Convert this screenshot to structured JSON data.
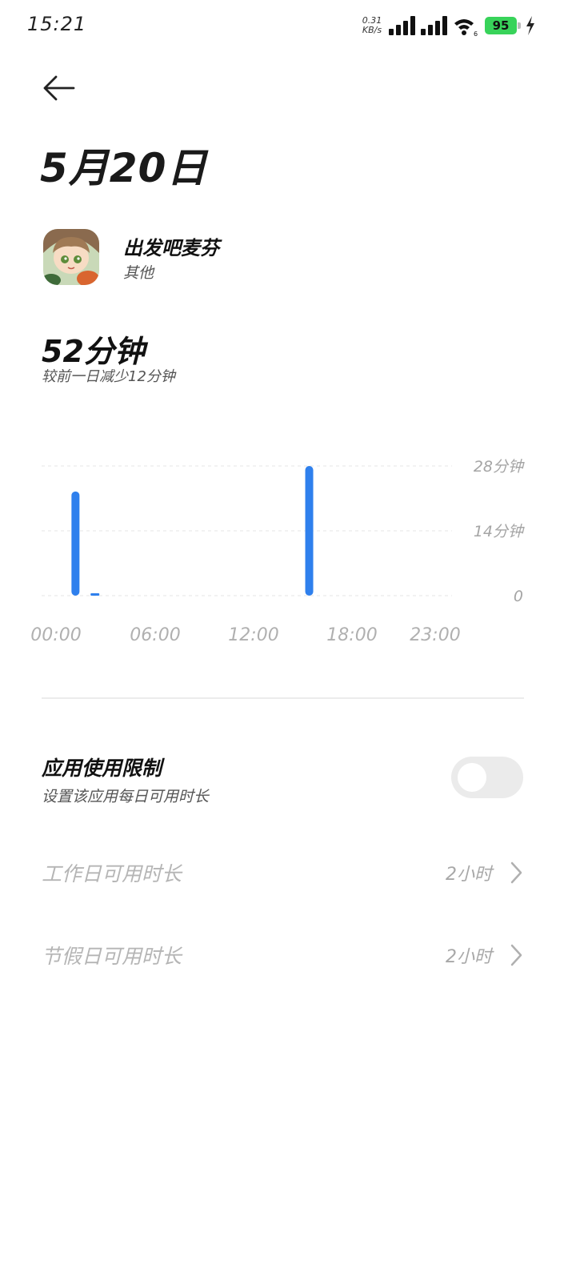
{
  "status_bar": {
    "time": "15:21",
    "net_speed_value": "0.31",
    "net_speed_unit": "KB/s",
    "battery": "95",
    "battery_color": "#38d35a"
  },
  "header": {
    "back_icon": "arrow-left-icon",
    "date_title": "5月20日"
  },
  "app": {
    "name": "出发吧麦芬",
    "category": "其他"
  },
  "usage": {
    "total": "52分钟",
    "compare": "较前一日减少12分钟"
  },
  "chart_data": {
    "type": "bar",
    "unit": "分钟",
    "ylim": [
      0,
      28
    ],
    "y_ticks": [
      {
        "value": 28,
        "label": "28分钟"
      },
      {
        "value": 14,
        "label": "14分钟"
      },
      {
        "value": 0,
        "label": "0"
      }
    ],
    "x_ticks": [
      "00:00",
      "06:00",
      "12:00",
      "18:00",
      "23:00"
    ],
    "hours": [
      0,
      1,
      2,
      3,
      4,
      5,
      6,
      7,
      8,
      9,
      10,
      11,
      12,
      13,
      14,
      15,
      16,
      17,
      18,
      19,
      20,
      21,
      22,
      23
    ],
    "values": [
      0,
      22.5,
      0.5,
      0,
      0,
      0,
      0,
      0,
      0,
      0,
      0,
      0,
      0,
      28,
      0,
      0,
      0,
      0,
      0,
      0,
      0,
      0,
      0,
      0
    ],
    "bar_color": "#2f80ed",
    "grid": true
  },
  "limit": {
    "title": "应用使用限制",
    "subtitle": "设置该应用每日可用时长",
    "enabled": false
  },
  "rows": [
    {
      "label": "工作日可用时长",
      "value": "2小时"
    },
    {
      "label": "节假日可用时长",
      "value": "2小时"
    }
  ]
}
